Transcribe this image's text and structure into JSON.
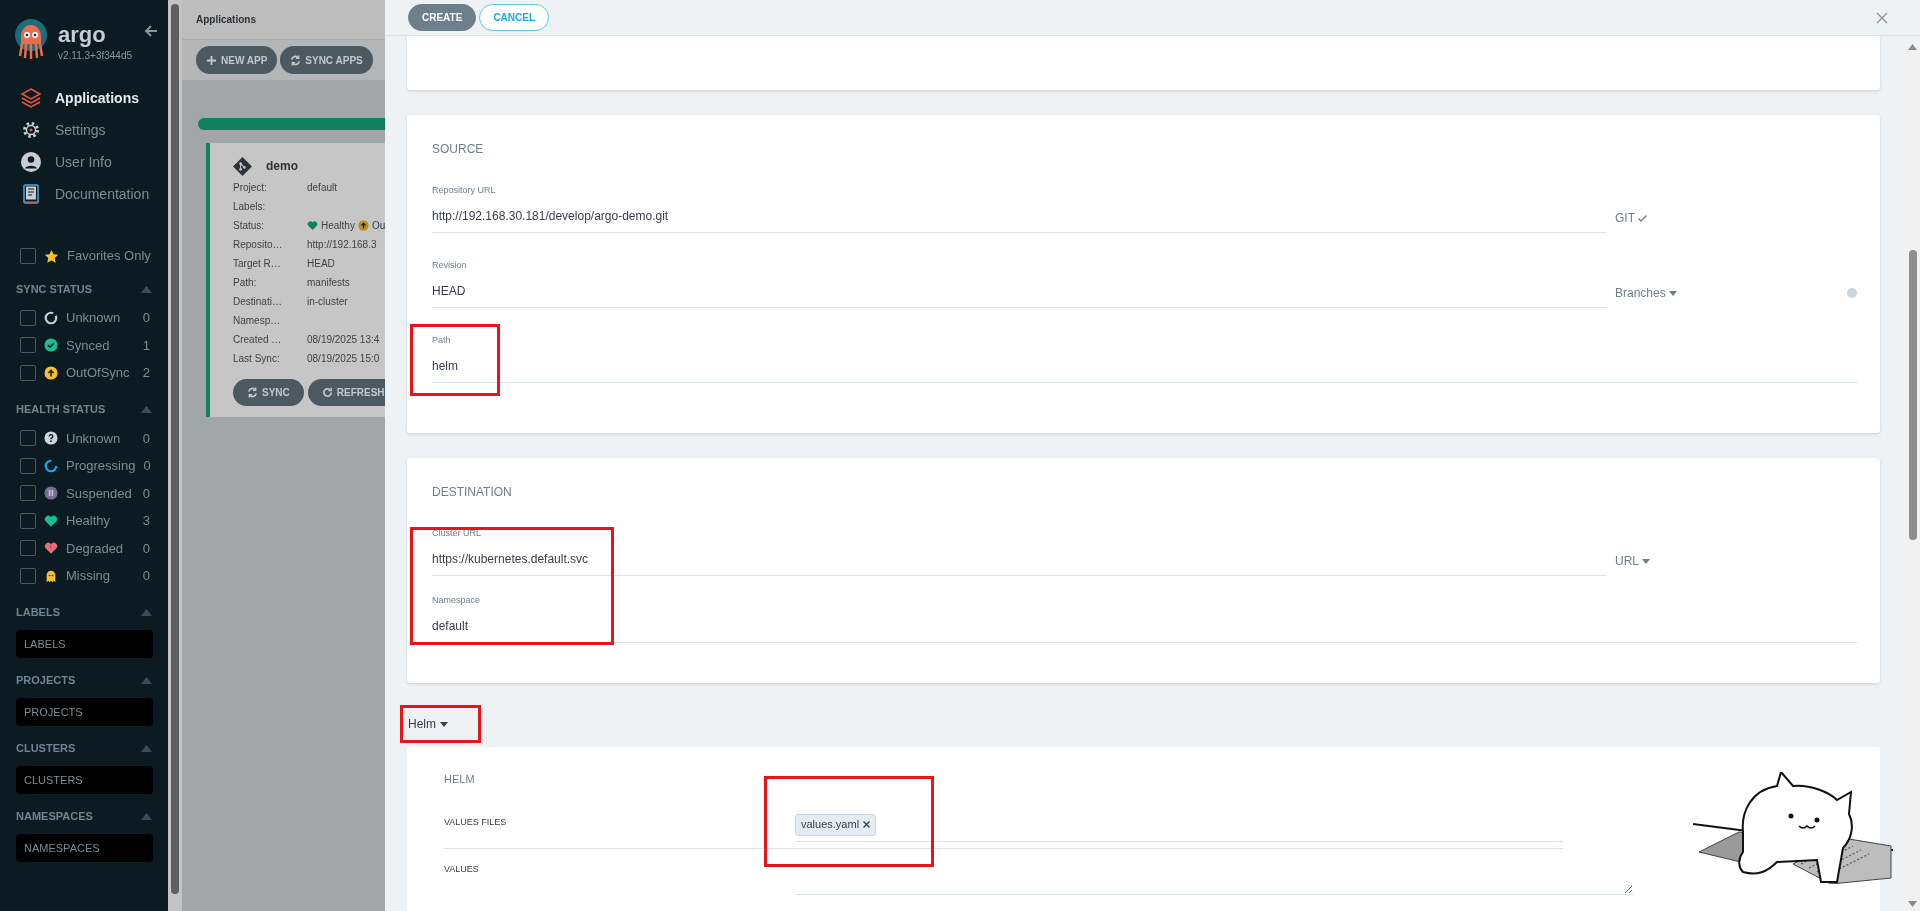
{
  "sidebar": {
    "logo_text": "argo",
    "version": "v2.11.3+3f344d5",
    "nav": [
      {
        "label": "Applications",
        "kind": "layers",
        "selected": true
      },
      {
        "label": "Settings",
        "kind": "gear",
        "selected": false
      },
      {
        "label": "User Info",
        "kind": "user",
        "selected": false
      },
      {
        "label": "Documentation",
        "kind": "book",
        "selected": false
      }
    ],
    "favorites": {
      "label": "Favorites Only",
      "checked": false
    },
    "filter_groups": [
      {
        "title": "SYNC STATUS",
        "kind": "checklist",
        "expanded": true,
        "items": [
          {
            "label": "Unknown",
            "count": "0",
            "checked": false,
            "kind": "ring",
            "color": "#c7cdd2"
          },
          {
            "label": "Synced",
            "count": "1",
            "checked": false,
            "kind": "check",
            "color": "#18be94"
          },
          {
            "label": "OutOfSync",
            "count": "2",
            "checked": false,
            "kind": "arrow",
            "color": "#f4c030"
          }
        ]
      },
      {
        "title": "HEALTH STATUS",
        "kind": "checklist",
        "expanded": true,
        "items": [
          {
            "label": "Unknown",
            "count": "0",
            "checked": false,
            "kind": "question",
            "color": "#ccd6dd"
          },
          {
            "label": "Progressing",
            "count": "0",
            "checked": false,
            "kind": "progress",
            "color": "#0dadea"
          },
          {
            "label": "Suspended",
            "count": "0",
            "checked": false,
            "kind": "pause",
            "color": "#766f94"
          },
          {
            "label": "Healthy",
            "count": "3",
            "checked": false,
            "kind": "heart",
            "color": "#18be94"
          },
          {
            "label": "Degraded",
            "count": "0",
            "checked": false,
            "kind": "broken-heart",
            "color": "#e96d76"
          },
          {
            "label": "Missing",
            "count": "0",
            "checked": false,
            "kind": "ghost",
            "color": "#f4c030"
          }
        ]
      },
      {
        "title": "LABELS",
        "kind": "input",
        "expanded": true,
        "placeholder": "LABELS"
      },
      {
        "title": "PROJECTS",
        "kind": "input",
        "expanded": true,
        "placeholder": "PROJECTS"
      },
      {
        "title": "CLUSTERS",
        "kind": "input",
        "expanded": true,
        "placeholder": "CLUSTERS"
      },
      {
        "title": "NAMESPACES",
        "kind": "input",
        "expanded": true,
        "placeholder": "NAMESPACES"
      }
    ]
  },
  "background": {
    "breadcrumb": "Applications",
    "toolbar": [
      {
        "label": "NEW APP",
        "kind": "plus"
      },
      {
        "label": "SYNC APPS",
        "kind": "sync"
      }
    ],
    "app_card": {
      "name": "demo",
      "fields": [
        {
          "label": "Project:",
          "value": "default"
        },
        {
          "label": "Labels:"
        },
        {
          "label": "Status:",
          "statuses": [
            {
              "kind": "heart",
              "label": "Healthy"
            },
            {
              "kind": "arrow",
              "label": "Ou"
            }
          ]
        },
        {
          "label": "Reposito…",
          "value": "http://192.168.3"
        },
        {
          "label": "Target R…",
          "value": "HEAD"
        },
        {
          "label": "Path:",
          "value": "manifests"
        },
        {
          "label": "Destinati…",
          "value": "in-cluster"
        },
        {
          "label": "Namesp…"
        },
        {
          "label": "Created …",
          "value": "08/19/2025 13:4"
        },
        {
          "label": "Last Sync:",
          "value": "08/19/2025 15:0"
        }
      ],
      "buttons": [
        {
          "label": "SYNC",
          "kind": "sync"
        },
        {
          "label": "REFRESH",
          "kind": "refresh"
        }
      ]
    }
  },
  "panel": {
    "buttons": [
      {
        "label": "CREATE",
        "kind": "primary"
      },
      {
        "label": "CANCEL",
        "kind": "outline"
      }
    ],
    "sections": [
      {
        "title": "SOURCE",
        "fields": [
          {
            "label": "Repository URL",
            "value": "http://192.168.30.181/develop/argo-demo.git",
            "addon": {
              "label": "GIT",
              "kind": "check"
            }
          },
          {
            "label": "Revision",
            "value": "HEAD",
            "addon": {
              "label": "Branches",
              "kind": "dropdown"
            },
            "help": true
          },
          {
            "label": "Path",
            "value": "helm"
          }
        ]
      },
      {
        "title": "DESTINATION",
        "fields": [
          {
            "label": "Cluster URL",
            "value": "https://kubernetes.default.svc",
            "addon": {
              "label": "URL",
              "kind": "dropdown"
            }
          },
          {
            "label": "Namespace",
            "value": "default"
          }
        ]
      }
    ],
    "source_type": {
      "label": "Helm"
    },
    "helm": {
      "title": "HELM",
      "rows": [
        {
          "label": "VALUES FILES",
          "kind": "tags",
          "tags": [
            "values.yaml"
          ]
        },
        {
          "label": "VALUES",
          "kind": "textarea"
        }
      ]
    }
  }
}
